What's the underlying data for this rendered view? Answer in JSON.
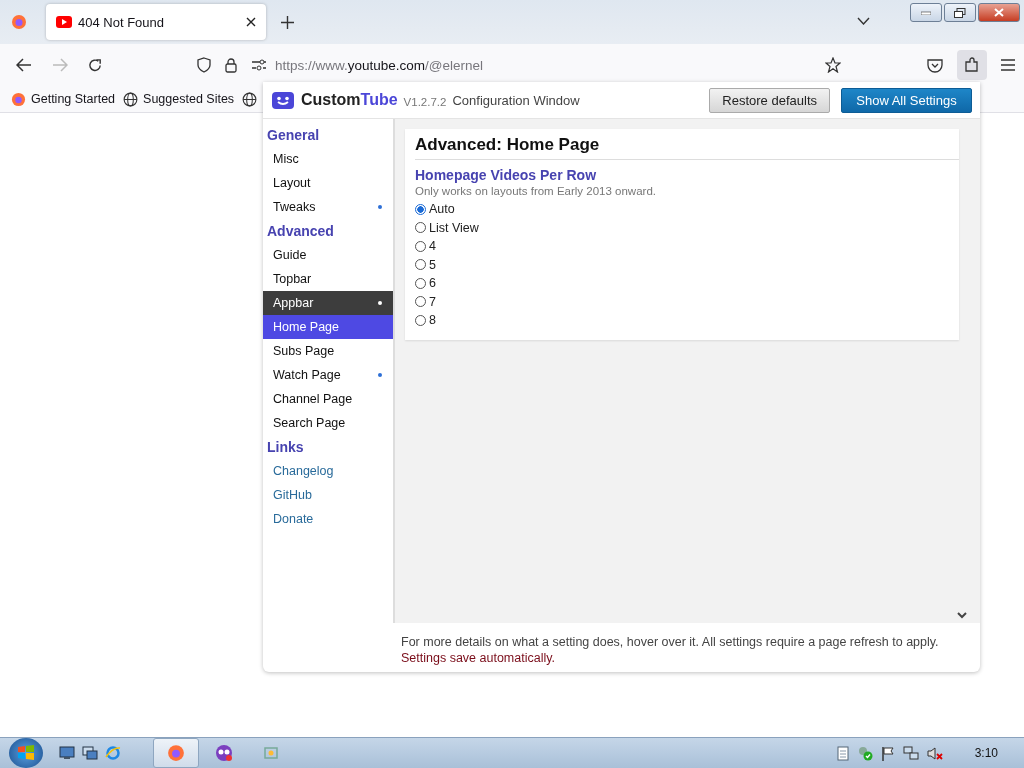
{
  "browser": {
    "tab": {
      "title": "404 Not Found",
      "selected": true
    },
    "url": {
      "scheme": "https://www.",
      "host": "youtube.com",
      "path": "/@elernel"
    },
    "bookmarks": [
      {
        "label": "Getting Started",
        "kind": "firefox"
      },
      {
        "label": "Suggested Sites",
        "kind": "globe"
      },
      {
        "kind": "globe"
      }
    ]
  },
  "popup": {
    "name_main": "Custom",
    "name_accent": "Tube",
    "version": "V1.2.7.2",
    "subtitle": "Configuration Window",
    "buttons": [
      {
        "label": "Restore defaults",
        "kind": "secondary"
      },
      {
        "label": "Show All Settings",
        "kind": "primary"
      }
    ],
    "sidebar": [
      {
        "heading": "General",
        "kind": "settings",
        "items": [
          {
            "label": "Misc",
            "selected": false,
            "hovered": false,
            "modified": false
          },
          {
            "label": "Layout",
            "selected": false,
            "hovered": false,
            "modified": false
          },
          {
            "label": "Tweaks",
            "selected": false,
            "hovered": false,
            "modified": true
          }
        ]
      },
      {
        "heading": "Advanced",
        "kind": "settings",
        "items": [
          {
            "label": "Guide",
            "selected": false,
            "hovered": false,
            "modified": false
          },
          {
            "label": "Topbar",
            "selected": false,
            "hovered": false,
            "modified": false
          },
          {
            "label": "Appbar",
            "selected": false,
            "hovered": true,
            "modified": true
          },
          {
            "label": "Home Page",
            "selected": true,
            "hovered": false,
            "modified": false
          },
          {
            "label": "Subs Page",
            "selected": false,
            "hovered": false,
            "modified": false
          },
          {
            "label": "Watch Page",
            "selected": false,
            "hovered": false,
            "modified": true
          },
          {
            "label": "Channel Page",
            "selected": false,
            "hovered": false,
            "modified": false
          },
          {
            "label": "Search Page",
            "selected": false,
            "hovered": false,
            "modified": false
          }
        ]
      },
      {
        "heading": "Links",
        "kind": "links",
        "items": [
          {
            "label": "Changelog",
            "selected": false,
            "hovered": false,
            "modified": false
          },
          {
            "label": "GitHub",
            "selected": false,
            "hovered": false,
            "modified": false
          },
          {
            "label": "Donate",
            "selected": false,
            "hovered": false,
            "modified": false
          }
        ]
      }
    ],
    "page_title": "Advanced: Home Page",
    "setting": {
      "title": "Homepage Videos Per Row",
      "description": "Only works on layouts from Early 2013 onward.",
      "options": [
        {
          "label": "Auto",
          "selected": true
        },
        {
          "label": "List View",
          "selected": false
        },
        {
          "label": "4",
          "selected": false
        },
        {
          "label": "5",
          "selected": false
        },
        {
          "label": "6",
          "selected": false
        },
        {
          "label": "7",
          "selected": false
        },
        {
          "label": "8",
          "selected": false
        }
      ]
    },
    "footer": {
      "info": "For more details on what a setting does, hover over it. All settings require a page refresh to apply.",
      "note": "Settings save automatically."
    }
  },
  "taskbar": {
    "clock": "3:10"
  }
}
